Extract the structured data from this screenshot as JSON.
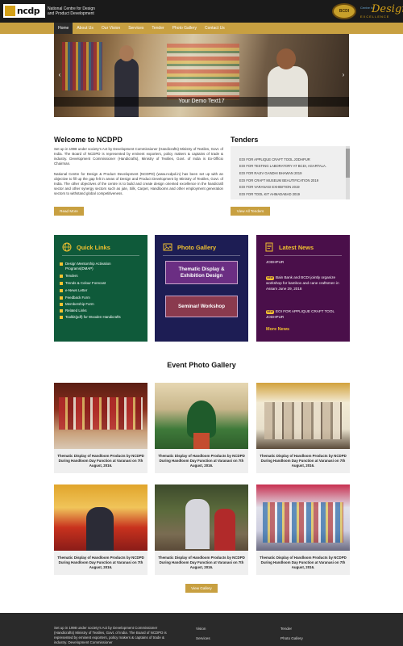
{
  "header": {
    "logo_text": "ncdp",
    "org_name_line1": "National Centre for Design",
    "org_name_line2": "and Product Development",
    "emblem_text": "BCDI",
    "brand_small": "Centre for",
    "brand_big": "Design",
    "brand_under": "EXCELLENCE"
  },
  "nav": {
    "items": [
      "Home",
      "About Us",
      "Our Vision",
      "Services",
      "Tender",
      "Photo Gallery",
      "Contact Us"
    ]
  },
  "slider": {
    "caption": "Your Demo Text17",
    "prev_glyph": "‹",
    "next_glyph": "›"
  },
  "welcome": {
    "title": "Welcome to NCDPD",
    "para1": "Set up in 1998 under society's Act by Development Commissioner (Handicrafts) Ministry of Textiles, Govt. of India. The Board of NCDPD is represented by eminent exporters, policy makers & captains of trade & industry. Development Commissioner (Handicrafts), Ministry of Textiles, Govt. of India is Ex-Officio Chairman.",
    "para2": "National Centre for Design & Product Development (NCDPD) (www.ncdpd.in) has been set up with an objective to fill up the gap felt in areas of Design and Product Development by Ministry of Textiles, Govt. of India. The other objectives of the centre is to build and create design oriented excellence in the handicraft sector and other synergy sectors such as jute, Silk, Carpet, Handlooms and other employment generation sectors to withstand global competitiveness.",
    "read_more": "Read More"
  },
  "tenders": {
    "title": "Tenders",
    "items": [
      "EOI FOR APPLIQUE CRAFT TOOL JODHPUR",
      "EOI FOR TESTING LABORATORY AT BCDI, AGARTALA.",
      "EOI FOR RAJIV GANDHI BHAWAN 2019",
      "EOI FOR CRAFT MUSEUM BEAUTIFICATION 2019",
      "EOI FOR VARANASI EXHIBITION 2019",
      "EOI FOR TOOL KIT AHMADABAD 2019"
    ],
    "view_all": "View All Tenders"
  },
  "quick_links": {
    "title": "Quick Links",
    "icon": "globe-icon",
    "items": [
      "Design Mentorship Activation Programs(DMAP)",
      "Tenders",
      "Trends & Colour Forecast",
      "e-News Letter",
      "Feedback Form",
      "Membership Form",
      "Related Links",
      "Toolkit(pdf) for Wooden Handicrafts"
    ]
  },
  "photo_gallery_panel": {
    "title": "Photo Gallery",
    "icon": "image-icon",
    "btn1": "Thematic Display & Exhibition Design",
    "btn2": "Seminar/ Workshop"
  },
  "latest_news": {
    "title": "Latest News",
    "icon": "news-icon",
    "badge": "NEW",
    "items": [
      "JODHPUR",
      "Bain Bank and BCDI jointly organize workshop for bamboo and cane craftsmen in Assam June 29, 2018",
      "EOI FOR APPLIQUE CRAFT TOOL JODHPUR"
    ],
    "more": "More News"
  },
  "event_gallery": {
    "title": "Event Photo Gallery",
    "cards": [
      {
        "caption": "Thematic Display of Handloom Products by NCDPD During Handloom Day Function at Varanasi on 7th August, 2016."
      },
      {
        "caption": "Thematic Display of Handloom Products by NCDPD During Handloom Day Function at Varanasi on 7th August, 2016."
      },
      {
        "caption": "Thematic Display of Handloom Products by NCDPD During Handloom Day Function at Varanasi on 7th August, 2016."
      },
      {
        "caption": "Thematic Display of Handloom Products by NCDPD During Handloom Day Function at Varanasi on 7th August, 2016."
      },
      {
        "caption": "Thematic Display of Handloom Products by NCDPD During Handloom Day Function at Varanasi on 7th August, 2016."
      },
      {
        "caption": "Thematic Display of Handloom Products by NCDPD During Handloom Day Function at Varanasi on 7th August, 2016."
      }
    ],
    "view_gallery": "View Gallery"
  },
  "footer": {
    "about": "Set up in 1998 under society's Act by Development Commissioner (Handicrafts) Ministry of Textiles, Govt. of India. The Board of NCDPD is represented by eminent exporters, policy makers & captains of trade & industry. Development Commissioner",
    "links_col1": [
      "Vision",
      "Services"
    ],
    "links_col2": [
      "Tender",
      "Photo Gallery"
    ]
  },
  "colors": {
    "gold": "#c8a041",
    "header_bg": "#1a1a1a",
    "quick_links_bg": "#0f5a3a",
    "gallery_bg": "#1d1d54",
    "news_bg": "#4a0f4a",
    "footer_bg": "#2a2a2a"
  }
}
